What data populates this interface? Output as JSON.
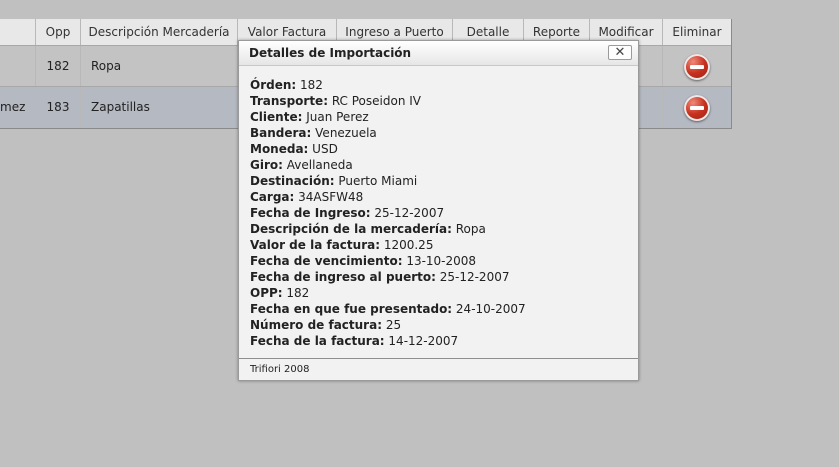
{
  "table": {
    "headers": {
      "client": "",
      "opp": "Opp",
      "description": "Descripción Mercadería",
      "invoice_value": "Valor Factura",
      "port_entry": "Ingreso a Puerto",
      "detail": "Detalle",
      "report": "Reporte",
      "modify": "Modificar",
      "delete": "Eliminar"
    },
    "rows": [
      {
        "client": "",
        "opp": "182",
        "description": "Ropa"
      },
      {
        "client": "mez",
        "opp": "183",
        "description": "Zapatillas"
      }
    ]
  },
  "dialog": {
    "title": "Detalles de Importación",
    "close_label": "✕",
    "fields": [
      {
        "label": "Órden:",
        "value": " 182"
      },
      {
        "label": "Transporte:",
        "value": " RC Poseidon IV"
      },
      {
        "label": "Cliente:",
        "value": " Juan Perez"
      },
      {
        "label": "Bandera:",
        "value": " Venezuela"
      },
      {
        "label": "Moneda:",
        "value": " USD"
      },
      {
        "label": "Giro:",
        "value": " Avellaneda"
      },
      {
        "label": "Destinación:",
        "value": " Puerto Miami"
      },
      {
        "label": "Carga:",
        "value": " 34ASFW48"
      },
      {
        "label": "Fecha de Ingreso:",
        "value": " 25-12-2007"
      },
      {
        "label": "Descripción de la mercadería:",
        "value": " Ropa"
      },
      {
        "label": "Valor de la factura:",
        "value": " 1200.25"
      },
      {
        "label": "Fecha de vencimiento:",
        "value": " 13-10-2008"
      },
      {
        "label": "Fecha de ingreso al puerto:",
        "value": " 25-12-2007"
      },
      {
        "label": "OPP:",
        "value": " 182"
      },
      {
        "label": "Fecha en que fue presentado:",
        "value": " 24-10-2007"
      },
      {
        "label": "Número de factura:",
        "value": " 25"
      },
      {
        "label": "Fecha de la factura:",
        "value": " 14-12-2007"
      }
    ],
    "footer": "Trifiori 2008"
  },
  "icons": {
    "delete": "delete-icon",
    "close": "close-icon"
  }
}
